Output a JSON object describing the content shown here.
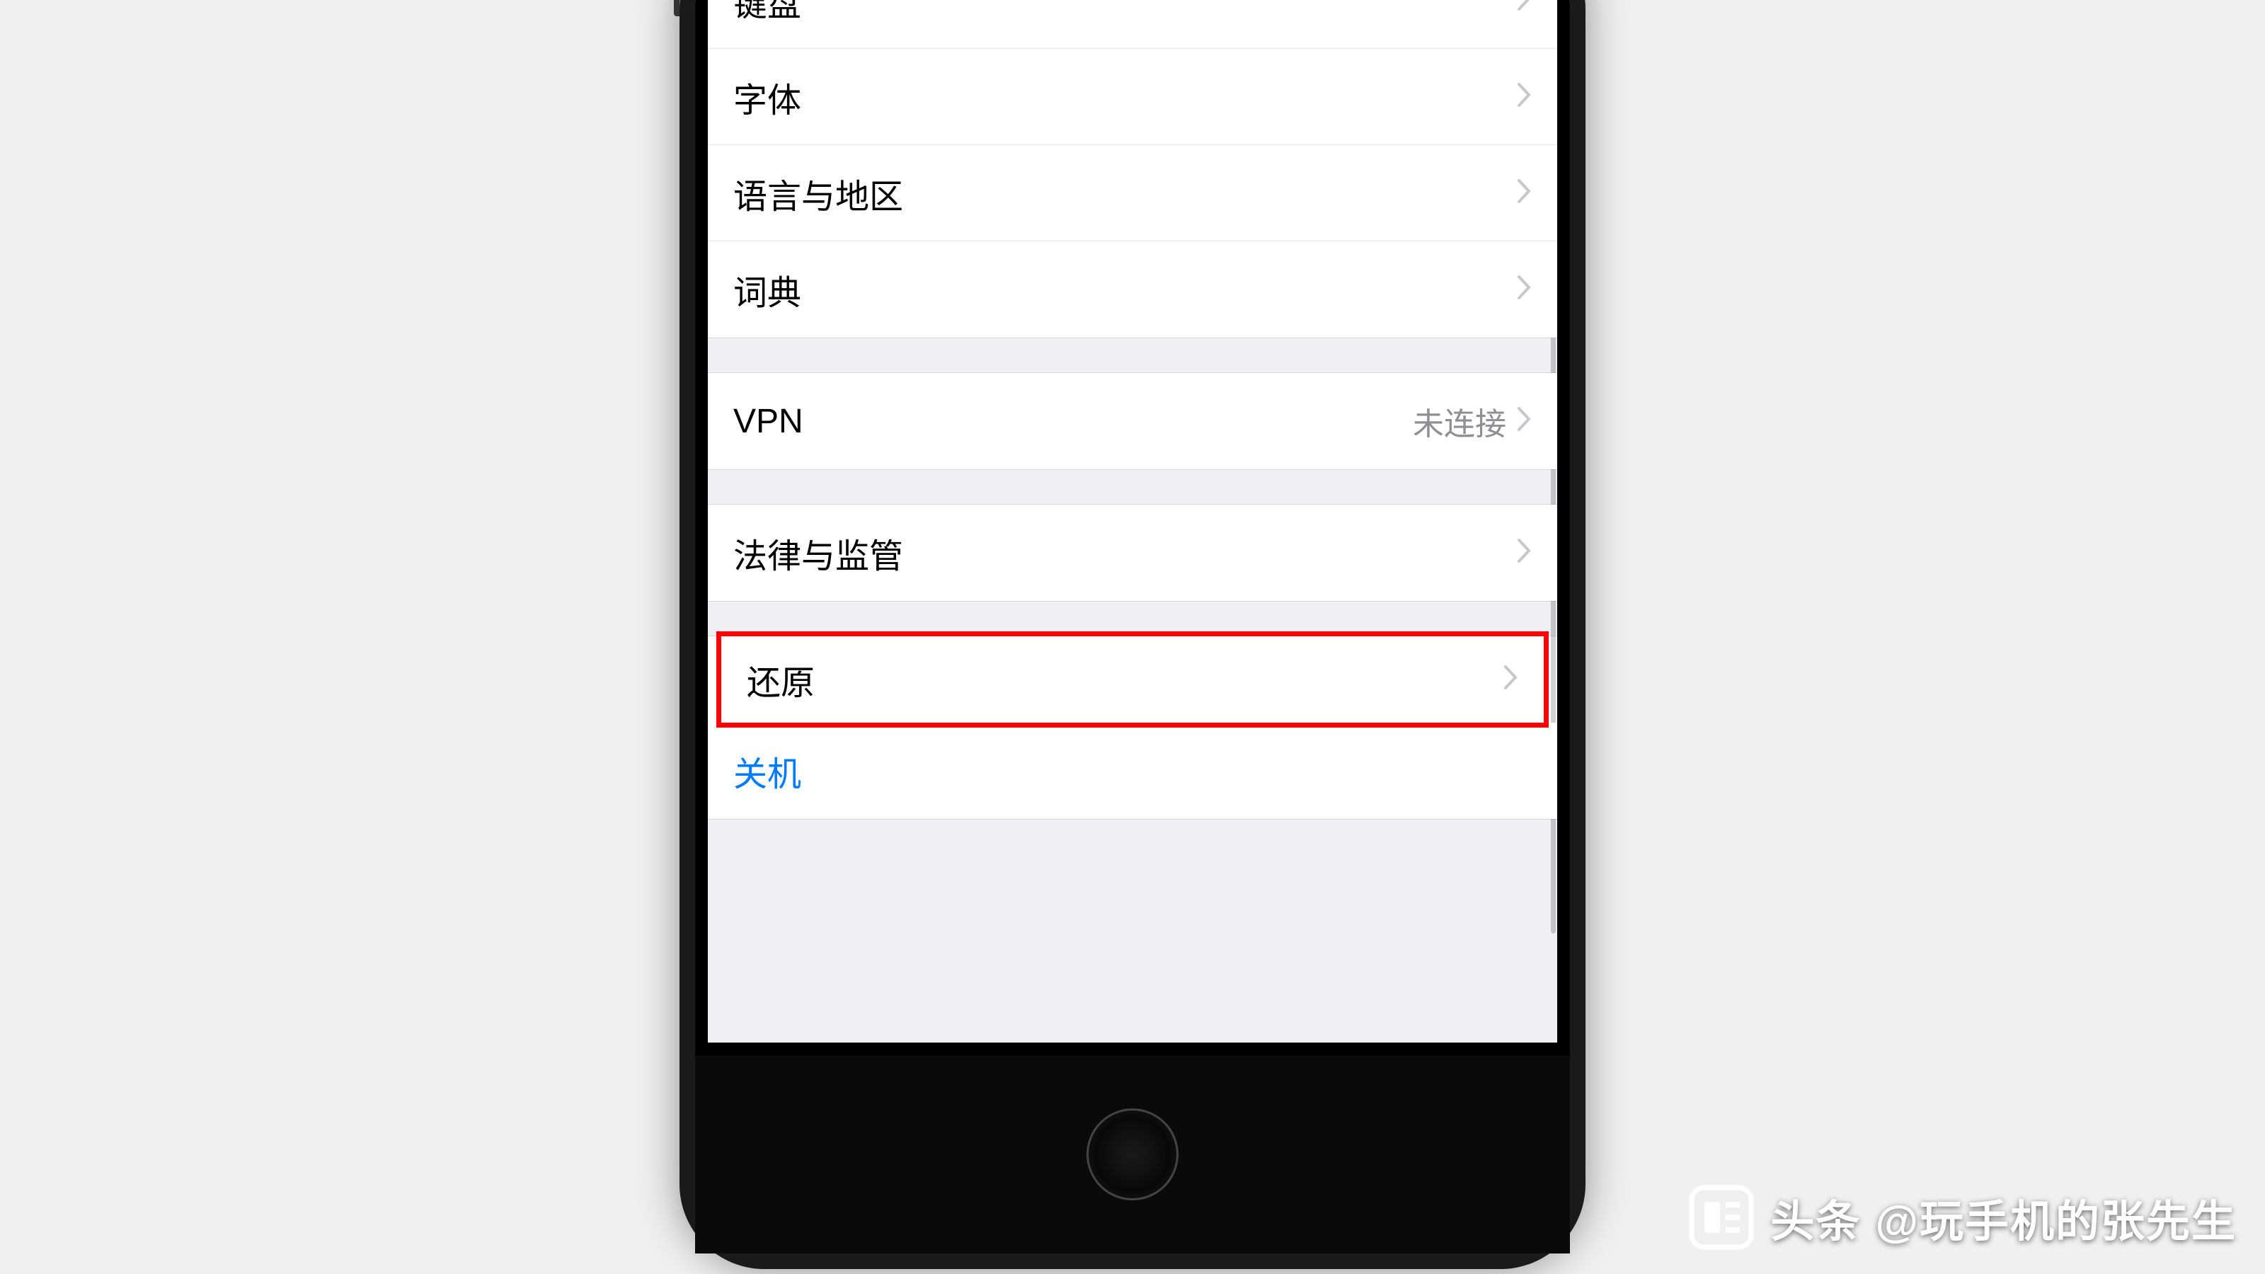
{
  "settings": {
    "section1": {
      "keyboard": "键盘",
      "fonts": "字体",
      "language_region": "语言与地区",
      "dictionary": "词典"
    },
    "section2": {
      "vpn_label": "VPN",
      "vpn_status": "未连接"
    },
    "section3": {
      "legal": "法律与监管"
    },
    "section4": {
      "reset": "还原",
      "shutdown": "关机"
    }
  },
  "watermark": {
    "brand": "头条",
    "author": "@玩手机的张先生"
  }
}
